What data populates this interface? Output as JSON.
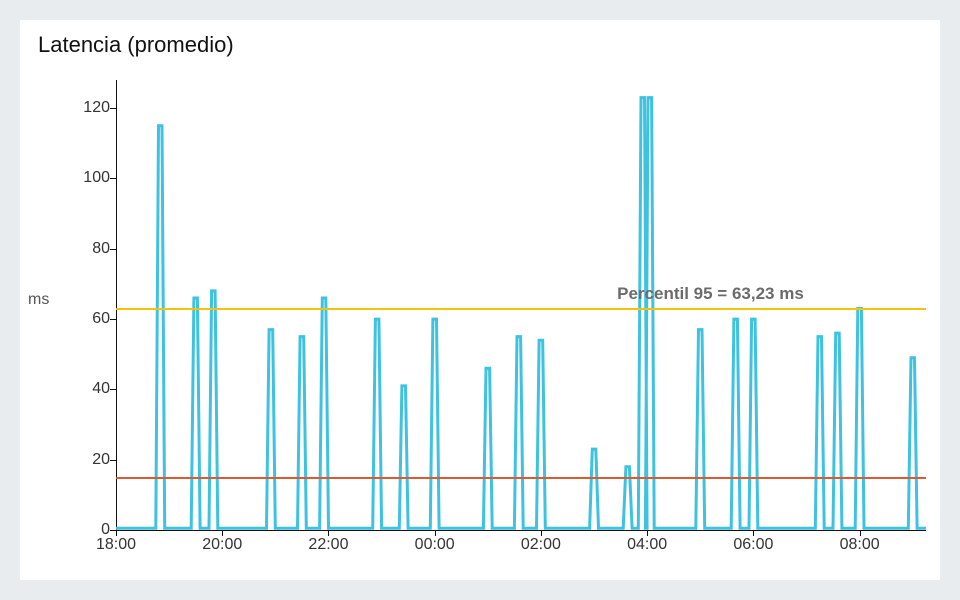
{
  "title": "Latencia (promedio)",
  "ylabel": "ms",
  "chart_data": {
    "type": "line",
    "title": "Latencia (promedio)",
    "xlabel": "",
    "ylabel": "ms",
    "x_ticks": [
      "18:00",
      "20:00",
      "22:00",
      "00:00",
      "02:00",
      "04:00",
      "06:00",
      "08:00"
    ],
    "y_ticks": [
      0,
      20,
      40,
      60,
      80,
      100,
      120
    ],
    "ylim": [
      0,
      128
    ],
    "x_range_minutes": [
      1080,
      1995
    ],
    "series": [
      {
        "name": "latency_avg_ms",
        "color": "#3fc2e0",
        "x_minutes": [
          1080,
          1125,
          1128,
          1132,
          1135,
          1140,
          1165,
          1168,
          1172,
          1175,
          1185,
          1188,
          1192,
          1195,
          1210,
          1250,
          1253,
          1257,
          1260,
          1285,
          1288,
          1292,
          1295,
          1310,
          1313,
          1317,
          1320,
          1335,
          1370,
          1373,
          1377,
          1380,
          1400,
          1403,
          1407,
          1410,
          1435,
          1438,
          1442,
          1445,
          1480,
          1495,
          1498,
          1502,
          1505,
          1530,
          1533,
          1537,
          1540,
          1555,
          1558,
          1562,
          1565,
          1590,
          1615,
          1618,
          1622,
          1625,
          1653,
          1656,
          1660,
          1663,
          1670,
          1673,
          1677,
          1680,
          1678,
          1681,
          1685,
          1688,
          1720,
          1735,
          1738,
          1742,
          1745,
          1775,
          1778,
          1782,
          1785,
          1795,
          1798,
          1802,
          1805,
          1830,
          1870,
          1873,
          1877,
          1880,
          1890,
          1893,
          1897,
          1900,
          1915,
          1918,
          1922,
          1925,
          1955,
          1975,
          1978,
          1982,
          1985,
          1995
        ],
        "y": [
          0.5,
          0.5,
          115,
          115,
          0.5,
          0.5,
          0.5,
          66,
          66,
          0.5,
          0.5,
          68,
          68,
          0.5,
          0.5,
          0.5,
          57,
          57,
          0.5,
          0.5,
          55,
          55,
          0.5,
          0.5,
          66,
          66,
          0.5,
          0.5,
          0.5,
          60,
          60,
          0.5,
          0.5,
          41,
          41,
          0.5,
          0.5,
          60,
          60,
          0.5,
          0.5,
          0.5,
          46,
          46,
          0.5,
          0.5,
          55,
          55,
          0.5,
          0.5,
          54,
          54,
          0.5,
          0.5,
          0.5,
          23,
          23,
          0.5,
          0.5,
          18,
          18,
          0.5,
          0.5,
          123,
          123,
          0.5,
          0.5,
          123,
          123,
          0.5,
          0.5,
          0.5,
          57,
          57,
          0.5,
          0.5,
          60,
          60,
          0.5,
          0.5,
          60,
          60,
          0.5,
          0.5,
          0.5,
          55,
          55,
          0.5,
          0.5,
          56,
          56,
          0.5,
          0.5,
          63,
          63,
          0.5,
          0.5,
          0.5,
          49,
          49,
          0.5,
          0.5
        ]
      }
    ],
    "reference_lines": [
      {
        "id": "p95",
        "value": 63.23,
        "label": "Percentil 95 = 63,23 ms",
        "color": "#f5c20a"
      },
      {
        "id": "redline",
        "value": 15,
        "label": "",
        "color": "#d95b33"
      }
    ]
  },
  "annotation": {
    "p95_label": "Percentil 95 = 63,23 ms"
  },
  "colors": {
    "series": "#3fc2e0",
    "p95_line": "#f5c20a",
    "red_line": "#d95b33",
    "background": "#e8ecef"
  }
}
